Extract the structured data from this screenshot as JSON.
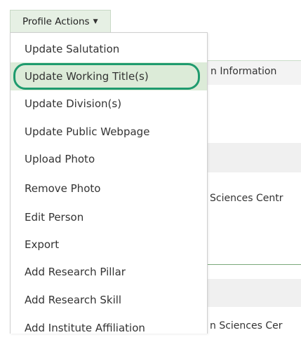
{
  "profile_actions": {
    "button_label": "Profile Actions",
    "caret_icon": "caret-down-icon",
    "menu_items": [
      {
        "label": "Update Salutation"
      },
      {
        "label": "Update Working Title(s)",
        "highlighted": true
      },
      {
        "label": "Update Division(s)"
      },
      {
        "label": "Update Public Webpage"
      },
      {
        "label": "Upload Photo"
      },
      {
        "label": "Remove Photo"
      },
      {
        "label": "Edit Person"
      },
      {
        "label": "Export"
      },
      {
        "label": "Add Research Pillar"
      },
      {
        "label": "Add Research Skill"
      },
      {
        "label": "Add Institute Affiliation"
      }
    ]
  },
  "background": {
    "tab_text": "n Information",
    "row_text_1": "Sciences Centr",
    "row_text_2": "n Sciences Cer"
  },
  "colors": {
    "button_bg": "#e6f0e4",
    "highlight_bg": "#dcebd8",
    "highlight_ring": "#1f9b6e",
    "divider": "#7aa87a"
  }
}
